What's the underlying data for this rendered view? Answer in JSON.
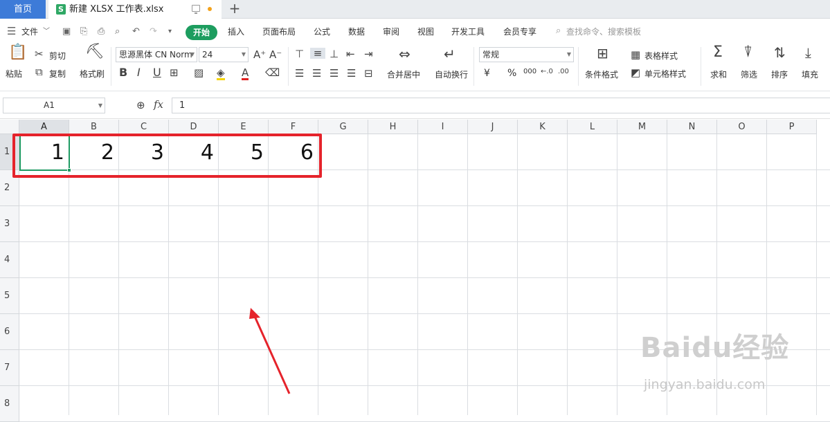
{
  "tabs": {
    "home": "首页",
    "doc_icon": "S",
    "doc_title": "新建 XLSX 工作表.xlsx",
    "add": "+"
  },
  "menu": {
    "file": "文件",
    "items": [
      "开始",
      "插入",
      "页面布局",
      "公式",
      "数据",
      "审阅",
      "视图",
      "开发工具",
      "会员专享"
    ],
    "search": "查找命令、搜索模板"
  },
  "ribbon": {
    "paste": "粘贴",
    "cut": "剪切",
    "copy": "复制",
    "format_painter": "格式刷",
    "font_name": "思源黑体 CN Norm",
    "font_size": "24",
    "merge_center": "合并居中",
    "wrap_text": "自动换行",
    "number_format": "常规",
    "currency": "¥",
    "percent": "%",
    "thousands": "000",
    "conditional_format": "条件格式",
    "table_style": "表格样式",
    "cell_style": "单元格样式",
    "sum": "求和",
    "filter": "筛选",
    "sort": "排序",
    "fill": "填充"
  },
  "formula_bar": {
    "name_box": "A1",
    "fx": "fx",
    "value": "1"
  },
  "grid": {
    "columns": [
      "A",
      "B",
      "C",
      "D",
      "E",
      "F",
      "G",
      "H",
      "I",
      "J",
      "K",
      "L",
      "M",
      "N",
      "O",
      "P"
    ],
    "rows": [
      "1",
      "2",
      "3",
      "4",
      "5",
      "6",
      "7",
      "8"
    ],
    "row1_values": [
      "1",
      "2",
      "3",
      "4",
      "5",
      "6"
    ],
    "selected_cell": "A1"
  },
  "colors": {
    "accent_green": "#1d9d5f",
    "home_tab_blue": "#3d7bd8",
    "annotation_red": "#e5232b"
  },
  "watermark": {
    "main": "Baidu经验",
    "sub": "jingyan.baidu.com"
  }
}
